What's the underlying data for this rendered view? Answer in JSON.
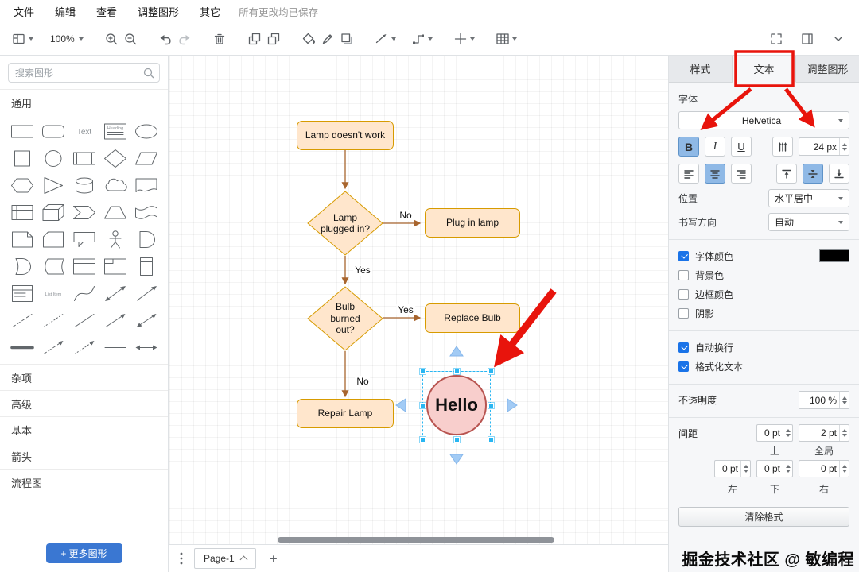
{
  "colors": {
    "accent_blue": "#1a73e8",
    "selected_button_bg": "#8fb9e6",
    "shape_fill": "#ffe6cc",
    "shape_stroke": "#d79b00",
    "circle_fill": "#f8cecc",
    "circle_stroke": "#b85450",
    "edge": "#a8652e",
    "selection_blue": "#29b6f2",
    "annotation_red": "#e8140c",
    "more_shapes_bg": "#3a77d2"
  },
  "menubar": {
    "items": [
      "文件",
      "编辑",
      "查看",
      "调整图形",
      "其它"
    ],
    "status": "所有更改均已保存"
  },
  "toolbar": {
    "zoom_value": "100%"
  },
  "sidebar": {
    "search_placeholder": "搜索图形",
    "general_section": "通用",
    "sections": [
      "杂项",
      "高级",
      "基本",
      "箭头",
      "流程图"
    ],
    "more_shapes_label": "+ 更多图形",
    "shapes": [
      "rectangle",
      "rounded-rectangle",
      "text",
      "textbox",
      "ellipse",
      "square",
      "circle",
      "process",
      "diamond",
      "parallelogram",
      "hexagon",
      "triangle",
      "cylinder",
      "cloud",
      "document",
      "internal-storage",
      "cube",
      "step",
      "trapezoid",
      "tape",
      "note",
      "card",
      "callout",
      "actor",
      "and",
      "or",
      "data-storage",
      "container",
      "titled-container",
      "vertical-container",
      "list",
      "list-item",
      "curve",
      "bidirectional-arrow",
      "diagonal-arrow",
      "dashed-line",
      "dotted-line",
      "solid-line",
      "thin-arrow",
      "thin-double-arrow",
      "link",
      "dashed-arrow",
      "dotted-arrow",
      "horizontal-line",
      "horizontal-double-arrow"
    ]
  },
  "canvas": {
    "nodes": {
      "start": "Lamp doesn't work",
      "decision1": "Lamp plugged in?",
      "plug": "Plug in lamp",
      "decision2": "Bulb burned out?",
      "replace": "Replace Bulb",
      "repair": "Repair Lamp",
      "hello": "Hello"
    },
    "edge_labels": {
      "no1": "No",
      "yes1": "Yes",
      "yes2": "Yes",
      "no2": "No"
    }
  },
  "bottombar": {
    "page_tab": "Page-1"
  },
  "panel": {
    "tabs": [
      "样式",
      "文本",
      "调整图形"
    ],
    "font_section_label": "字体",
    "font_family": "Helvetica",
    "font_size": "24 px",
    "position_label": "位置",
    "position_value": "水平居中",
    "direction_label": "书写方向",
    "direction_value": "自动",
    "font_color_label": "字体颜色",
    "background_label": "背景色",
    "border_color_label": "边框颜色",
    "shadow_label": "阴影",
    "word_wrap_label": "自动换行",
    "formatted_label": "格式化文本",
    "opacity_label": "不透明度",
    "opacity_value": "100 %",
    "spacing_label": "间距",
    "spacing_top": "0 pt",
    "spacing_global": "2 pt",
    "spacing_left": "0 pt",
    "spacing_bottom": "0 pt",
    "spacing_right": "0 pt",
    "spacing_top_label": "上",
    "spacing_global_label": "全局",
    "spacing_left_label": "左",
    "spacing_bottom_label": "下",
    "spacing_right_label": "右",
    "clear_format_label": "清除格式"
  },
  "watermark": "掘金技术社区 @ 敏编程"
}
